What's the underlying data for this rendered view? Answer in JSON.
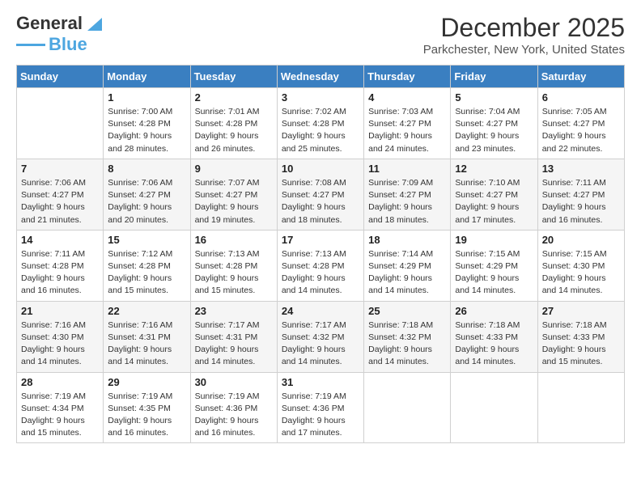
{
  "header": {
    "logo_line1": "General",
    "logo_line2": "Blue",
    "main_title": "December 2025",
    "subtitle": "Parkchester, New York, United States"
  },
  "days_of_week": [
    "Sunday",
    "Monday",
    "Tuesday",
    "Wednesday",
    "Thursday",
    "Friday",
    "Saturday"
  ],
  "weeks": [
    [
      {
        "day": "",
        "info": ""
      },
      {
        "day": "1",
        "info": "Sunrise: 7:00 AM\nSunset: 4:28 PM\nDaylight: 9 hours\nand 28 minutes."
      },
      {
        "day": "2",
        "info": "Sunrise: 7:01 AM\nSunset: 4:28 PM\nDaylight: 9 hours\nand 26 minutes."
      },
      {
        "day": "3",
        "info": "Sunrise: 7:02 AM\nSunset: 4:28 PM\nDaylight: 9 hours\nand 25 minutes."
      },
      {
        "day": "4",
        "info": "Sunrise: 7:03 AM\nSunset: 4:27 PM\nDaylight: 9 hours\nand 24 minutes."
      },
      {
        "day": "5",
        "info": "Sunrise: 7:04 AM\nSunset: 4:27 PM\nDaylight: 9 hours\nand 23 minutes."
      },
      {
        "day": "6",
        "info": "Sunrise: 7:05 AM\nSunset: 4:27 PM\nDaylight: 9 hours\nand 22 minutes."
      }
    ],
    [
      {
        "day": "7",
        "info": "Sunrise: 7:06 AM\nSunset: 4:27 PM\nDaylight: 9 hours\nand 21 minutes."
      },
      {
        "day": "8",
        "info": "Sunrise: 7:06 AM\nSunset: 4:27 PM\nDaylight: 9 hours\nand 20 minutes."
      },
      {
        "day": "9",
        "info": "Sunrise: 7:07 AM\nSunset: 4:27 PM\nDaylight: 9 hours\nand 19 minutes."
      },
      {
        "day": "10",
        "info": "Sunrise: 7:08 AM\nSunset: 4:27 PM\nDaylight: 9 hours\nand 18 minutes."
      },
      {
        "day": "11",
        "info": "Sunrise: 7:09 AM\nSunset: 4:27 PM\nDaylight: 9 hours\nand 18 minutes."
      },
      {
        "day": "12",
        "info": "Sunrise: 7:10 AM\nSunset: 4:27 PM\nDaylight: 9 hours\nand 17 minutes."
      },
      {
        "day": "13",
        "info": "Sunrise: 7:11 AM\nSunset: 4:27 PM\nDaylight: 9 hours\nand 16 minutes."
      }
    ],
    [
      {
        "day": "14",
        "info": "Sunrise: 7:11 AM\nSunset: 4:28 PM\nDaylight: 9 hours\nand 16 minutes."
      },
      {
        "day": "15",
        "info": "Sunrise: 7:12 AM\nSunset: 4:28 PM\nDaylight: 9 hours\nand 15 minutes."
      },
      {
        "day": "16",
        "info": "Sunrise: 7:13 AM\nSunset: 4:28 PM\nDaylight: 9 hours\nand 15 minutes."
      },
      {
        "day": "17",
        "info": "Sunrise: 7:13 AM\nSunset: 4:28 PM\nDaylight: 9 hours\nand 14 minutes."
      },
      {
        "day": "18",
        "info": "Sunrise: 7:14 AM\nSunset: 4:29 PM\nDaylight: 9 hours\nand 14 minutes."
      },
      {
        "day": "19",
        "info": "Sunrise: 7:15 AM\nSunset: 4:29 PM\nDaylight: 9 hours\nand 14 minutes."
      },
      {
        "day": "20",
        "info": "Sunrise: 7:15 AM\nSunset: 4:30 PM\nDaylight: 9 hours\nand 14 minutes."
      }
    ],
    [
      {
        "day": "21",
        "info": "Sunrise: 7:16 AM\nSunset: 4:30 PM\nDaylight: 9 hours\nand 14 minutes."
      },
      {
        "day": "22",
        "info": "Sunrise: 7:16 AM\nSunset: 4:31 PM\nDaylight: 9 hours\nand 14 minutes."
      },
      {
        "day": "23",
        "info": "Sunrise: 7:17 AM\nSunset: 4:31 PM\nDaylight: 9 hours\nand 14 minutes."
      },
      {
        "day": "24",
        "info": "Sunrise: 7:17 AM\nSunset: 4:32 PM\nDaylight: 9 hours\nand 14 minutes."
      },
      {
        "day": "25",
        "info": "Sunrise: 7:18 AM\nSunset: 4:32 PM\nDaylight: 9 hours\nand 14 minutes."
      },
      {
        "day": "26",
        "info": "Sunrise: 7:18 AM\nSunset: 4:33 PM\nDaylight: 9 hours\nand 14 minutes."
      },
      {
        "day": "27",
        "info": "Sunrise: 7:18 AM\nSunset: 4:33 PM\nDaylight: 9 hours\nand 15 minutes."
      }
    ],
    [
      {
        "day": "28",
        "info": "Sunrise: 7:19 AM\nSunset: 4:34 PM\nDaylight: 9 hours\nand 15 minutes."
      },
      {
        "day": "29",
        "info": "Sunrise: 7:19 AM\nSunset: 4:35 PM\nDaylight: 9 hours\nand 16 minutes."
      },
      {
        "day": "30",
        "info": "Sunrise: 7:19 AM\nSunset: 4:36 PM\nDaylight: 9 hours\nand 16 minutes."
      },
      {
        "day": "31",
        "info": "Sunrise: 7:19 AM\nSunset: 4:36 PM\nDaylight: 9 hours\nand 17 minutes."
      },
      {
        "day": "",
        "info": ""
      },
      {
        "day": "",
        "info": ""
      },
      {
        "day": "",
        "info": ""
      }
    ]
  ]
}
